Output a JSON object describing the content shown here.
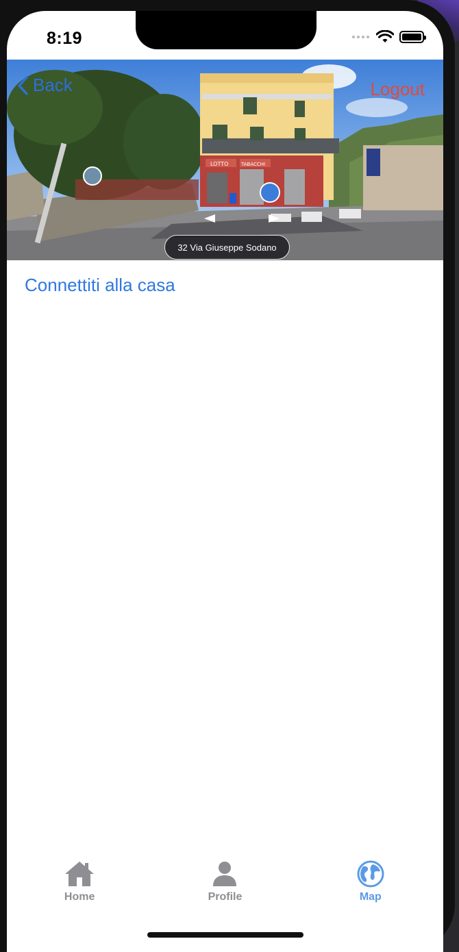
{
  "status_bar": {
    "time": "8:19"
  },
  "nav": {
    "back_label": "Back",
    "logout_label": "Logout"
  },
  "street_view": {
    "address": "32 Via Giuseppe Sodano",
    "sign_lotto": "LOTTO",
    "sign_tabacchi": "TABACCHI"
  },
  "content": {
    "connect_label": "Connettiti alla casa"
  },
  "tabs": [
    {
      "label": "Home",
      "icon": "house-icon",
      "active": false
    },
    {
      "label": "Profile",
      "icon": "person-icon",
      "active": false
    },
    {
      "label": "Map",
      "icon": "globe-icon",
      "active": true
    }
  ],
  "colors": {
    "accent": "#2f78e0",
    "logout": "#e24a3b",
    "tab_active": "#5b9be6",
    "tab_inactive": "#8e8e93"
  }
}
